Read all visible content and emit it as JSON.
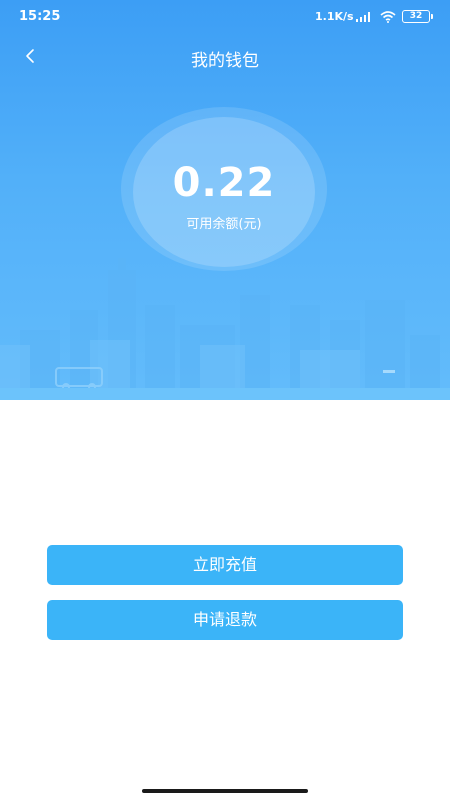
{
  "status_bar": {
    "time": "15:25",
    "network_speed": "1.1K/s",
    "battery_level": "32",
    "icons": [
      "signal-icon",
      "wifi-icon",
      "battery-icon"
    ]
  },
  "header": {
    "title": "我的钱包",
    "back_icon": "chevron-left-icon"
  },
  "wallet": {
    "balance": "0.22",
    "balance_label": "可用余额(元)"
  },
  "actions": {
    "recharge_label": "立即充值",
    "refund_label": "申请退款"
  },
  "colors": {
    "hero_top": "#3c9ef5",
    "hero_bottom": "#63bcfb",
    "button": "#3bb4f8",
    "text_on_blue": "#ffffff"
  }
}
